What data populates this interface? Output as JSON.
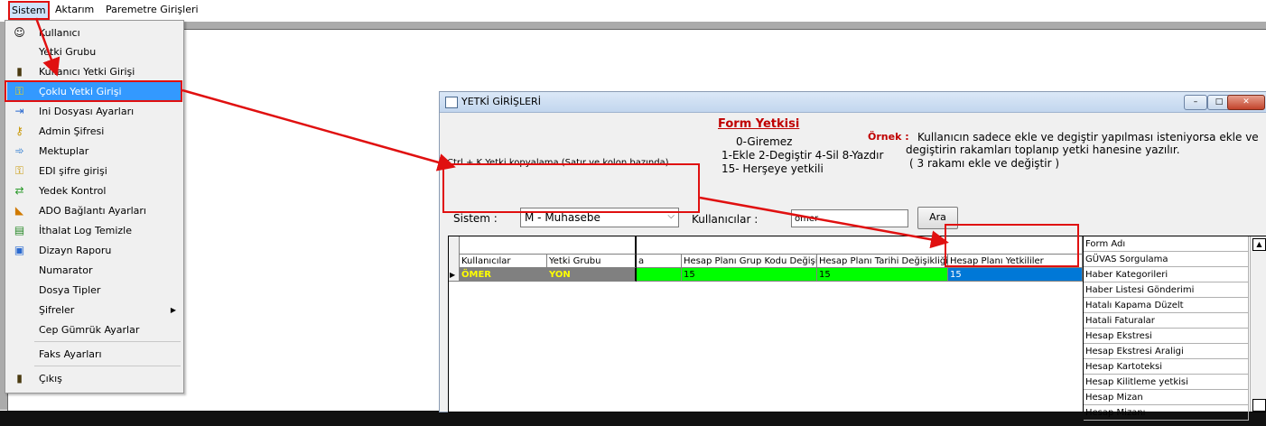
{
  "menubar": {
    "items": [
      {
        "label": "Sistem"
      },
      {
        "label": "Aktarım"
      },
      {
        "label": "Paremetre Girişleri"
      }
    ]
  },
  "sistem_menu": {
    "items": [
      {
        "label": "Kullanıcı",
        "icon": "user-icon"
      },
      {
        "label": "Yetki Grubu",
        "icon": ""
      },
      {
        "label": "Kullanıcı Yetki Girişi",
        "icon": "door-icon"
      },
      {
        "label": "Çoklu Yetki Girişi",
        "icon": "keys-icon"
      },
      {
        "label": "Ini Dosyası Ayarları",
        "icon": "file-arrow-icon"
      },
      {
        "label": "Admin Şifresi",
        "icon": "key-icon"
      },
      {
        "label": "Mektuplar",
        "icon": "letter-icon"
      },
      {
        "label": "EDI şifre girişi",
        "icon": "keys-icon"
      },
      {
        "label": "Yedek Kontrol",
        "icon": "backup-icon"
      },
      {
        "label": "ADO Bağlantı Ayarları",
        "icon": "connection-icon"
      },
      {
        "label": "İthalat Log Temizle",
        "icon": "broom-icon"
      },
      {
        "label": "Dizayn Raporu",
        "icon": "report-icon"
      },
      {
        "label": "Numarator",
        "icon": ""
      },
      {
        "label": "Dosya Tipler",
        "icon": ""
      },
      {
        "label": "Şifreler",
        "icon": ""
      },
      {
        "label": "Cep Gümrük Ayarlar",
        "icon": ""
      },
      {
        "label": "Faks Ayarları",
        "icon": ""
      },
      {
        "label": "Çıkış",
        "icon": "exit-door-icon"
      }
    ]
  },
  "window": {
    "title": "YETKİ GİRİŞLERİ",
    "buttons": {
      "minimize": "–",
      "maximize": "□",
      "close": "✕"
    },
    "form_yetkisi_title": "Form Yetkisi",
    "legend": {
      "l1": "0-Giremez",
      "l2": "1-Ekle 2-Degiştir 4-Sil 8-Yazdır",
      "l3": "15- Herşeye yetkili"
    },
    "ornek_label": "Örnek :",
    "ornek_text1": "Kullanıcın sadece ekle ve degiştir yapılması isteniyorsa ekle ve",
    "ornek_text2": "degiştirin rakamları toplanıp yetki hanesine yazılır.",
    "ornek_text3": "( 3 rakamı ekle ve değiştir )",
    "ctrl_hint": "Ctrl + K Yetki kopyalama (Satır ve kolon bazında)",
    "sistem_label": "Sistem :",
    "sistem_value": "M - Muhasebe",
    "kullanicilar_label": "Kullanıcılar :",
    "kullanicilar_value": "ömer",
    "ara_button": "Ara"
  },
  "grid": {
    "headers": {
      "kullanicilar": "Kullanıcılar",
      "yetki_grubu": "Yetki Grubu",
      "col3": "a",
      "grup_kodu": "Hesap Planı Grup Kodu Değişil",
      "tarih": "Hesap Planı Tarihi Değişikliği",
      "yetkililer": "Hesap Planı Yetkililer"
    },
    "row": {
      "kullanici": "ÖMER",
      "yetki_grubu": "YON",
      "grup_kodu": "15",
      "tarih": "15",
      "yetkililer": "15"
    },
    "colors": {
      "user_bg": "#808080",
      "user_fg": "#ffff00",
      "green": "#00ff00",
      "selected": "#0078d7"
    }
  },
  "form_list": {
    "header": "Form Adı",
    "items": [
      "GÜVAS Sorgulama",
      "Haber Kategorileri",
      "Haber Listesi Gönderimi",
      "Hatalı Kapama Düzelt",
      "Hatali Faturalar",
      "Hesap Ekstresi",
      "Hesap Ekstresi Araligi",
      "Hesap Kartoteksi",
      "Hesap Kilitleme yetkisi",
      "Hesap Mizan",
      "Hesap Mizanı"
    ]
  }
}
